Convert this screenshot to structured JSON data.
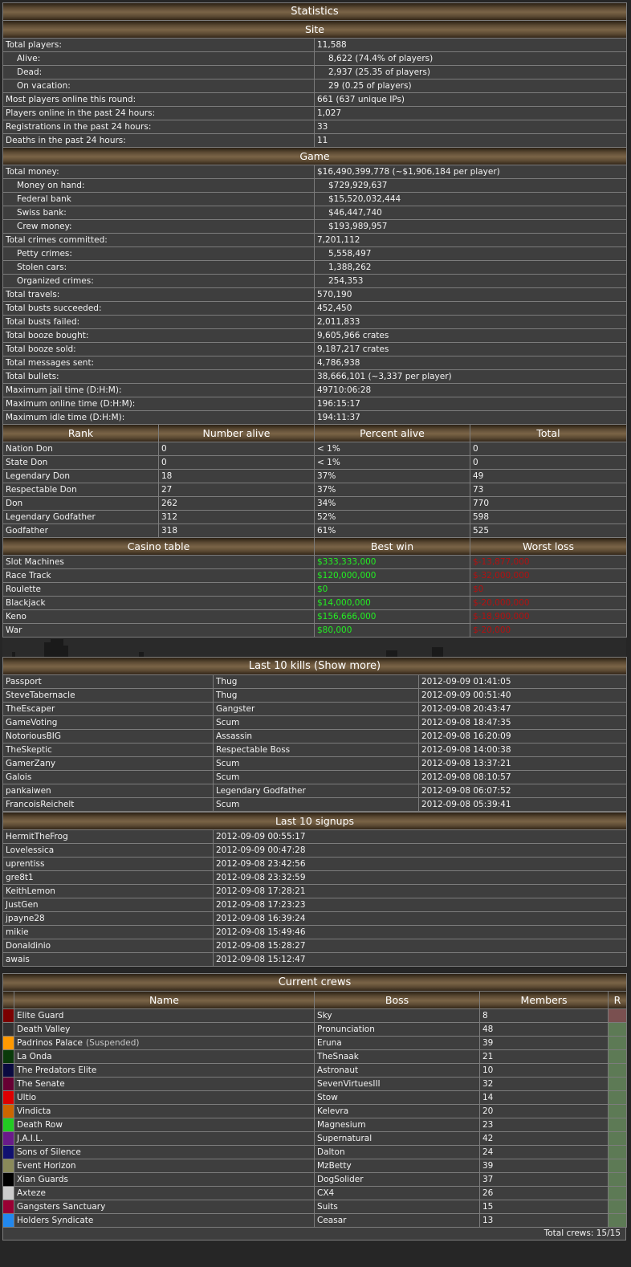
{
  "stats": {
    "title": "Statistics",
    "site": {
      "title": "Site",
      "rows": [
        {
          "label": "Total players:",
          "value": "11,588",
          "indent": false
        },
        {
          "label": "Alive:",
          "value": "8,622 (74.4% of players)",
          "indent": true
        },
        {
          "label": "Dead:",
          "value": "2,937 (25.35 of players)",
          "indent": true
        },
        {
          "label": "On vacation:",
          "value": "29 (0.25 of players)",
          "indent": true
        },
        {
          "label": "Most players online this round:",
          "value": "661 (637 unique IPs)",
          "indent": false
        },
        {
          "label": "Players online in the past 24 hours:",
          "value": "1,027",
          "indent": false
        },
        {
          "label": "Registrations in the past 24 hours:",
          "value": "33",
          "indent": false
        },
        {
          "label": "Deaths in the past 24 hours:",
          "value": "11",
          "indent": false
        }
      ]
    },
    "game": {
      "title": "Game",
      "rows": [
        {
          "label": "Total money:",
          "value": "$16,490,399,778 (~$1,906,184 per player)",
          "indent": false
        },
        {
          "label": "Money on hand:",
          "value": "$729,929,637",
          "indent": true
        },
        {
          "label": "Federal bank",
          "value": "$15,520,032,444",
          "indent": true
        },
        {
          "label": "Swiss bank:",
          "value": "$46,447,740",
          "indent": true
        },
        {
          "label": "Crew money:",
          "value": "$193,989,957",
          "indent": true
        },
        {
          "label": "Total crimes committed:",
          "value": "7,201,112",
          "indent": false
        },
        {
          "label": "Petty crimes:",
          "value": "5,558,497",
          "indent": true
        },
        {
          "label": "Stolen cars:",
          "value": "1,388,262",
          "indent": true
        },
        {
          "label": "Organized crimes:",
          "value": "254,353",
          "indent": true
        },
        {
          "label": "Total travels:",
          "value": "570,190",
          "indent": false
        },
        {
          "label": "Total busts succeeded:",
          "value": "452,450",
          "indent": false
        },
        {
          "label": "Total busts failed:",
          "value": "2,011,833",
          "indent": false
        },
        {
          "label": "Total booze bought:",
          "value": "9,605,966 crates",
          "indent": false
        },
        {
          "label": "Total booze sold:",
          "value": "9,187,217 crates",
          "indent": false
        },
        {
          "label": "Total messages sent:",
          "value": "4,786,938",
          "indent": false
        },
        {
          "label": "Total bullets:",
          "value": "38,666,101 (~3,337 per player)",
          "indent": false
        },
        {
          "label": "Maximum jail time (D:H:M):",
          "value": "49710:06:28",
          "indent": false
        },
        {
          "label": "Maximum online time (D:H:M):",
          "value": "196:15:17",
          "indent": false
        },
        {
          "label": "Maximum idle time (D:H:M):",
          "value": "194:11:37",
          "indent": false
        }
      ]
    },
    "ranks": {
      "headers": [
        "Rank",
        "Number alive",
        "Percent alive",
        "Total"
      ],
      "rows": [
        [
          "Nation Don",
          "0",
          "< 1%",
          "0"
        ],
        [
          "State Don",
          "0",
          "< 1%",
          "0"
        ],
        [
          "Legendary Don",
          "18",
          "37%",
          "49"
        ],
        [
          "Respectable Don",
          "27",
          "37%",
          "73"
        ],
        [
          "Don",
          "262",
          "34%",
          "770"
        ],
        [
          "Legendary Godfather",
          "312",
          "52%",
          "598"
        ],
        [
          "Godfather",
          "318",
          "61%",
          "525"
        ]
      ]
    },
    "casino": {
      "headers": [
        "Casino table",
        "Best win",
        "Worst loss"
      ],
      "rows": [
        [
          "Slot Machines",
          "$333,333,000",
          "$-13,877,000"
        ],
        [
          "Race Track",
          "$120,000,000",
          "$-32,000,000"
        ],
        [
          "Roulette",
          "$0",
          "$0"
        ],
        [
          "Blackjack",
          "$14,000,000",
          "$-20,000,000"
        ],
        [
          "Keno",
          "$156,666,000",
          "$-18,900,000"
        ],
        [
          "War",
          "$80,000",
          "$-20,000"
        ]
      ],
      "win_color": "#22ee22",
      "loss_color": "#b41010"
    }
  },
  "kills": {
    "title": "Last 10 kills (Show more)",
    "rows": [
      [
        "Passport",
        "Thug",
        "2012-09-09 01:41:05"
      ],
      [
        "SteveTabernacle",
        "Thug",
        "2012-09-09 00:51:40"
      ],
      [
        "TheEscaper",
        "Gangster",
        "2012-09-08 20:43:47"
      ],
      [
        "GameVoting",
        "Scum",
        "2012-09-08 18:47:35"
      ],
      [
        "NotoriousBIG",
        "Assassin",
        "2012-09-08 16:20:09"
      ],
      [
        "TheSkeptic",
        "Respectable Boss",
        "2012-09-08 14:00:38"
      ],
      [
        "GamerZany",
        "Scum",
        "2012-09-08 13:37:21"
      ],
      [
        "Galois",
        "Scum",
        "2012-09-08 08:10:57"
      ],
      [
        "pankaiwen",
        "Legendary Godfather",
        "2012-09-08 06:07:52"
      ],
      [
        "FrancoisReichelt",
        "Scum",
        "2012-09-08 05:39:41"
      ]
    ]
  },
  "signups": {
    "title": "Last 10 signups",
    "rows": [
      [
        "HermitTheFrog",
        "2012-09-09 00:55:17"
      ],
      [
        "Lovelessica",
        "2012-09-09 00:47:28"
      ],
      [
        "uprentiss",
        "2012-09-08 23:42:56"
      ],
      [
        "gre8t1",
        "2012-09-08 23:32:59"
      ],
      [
        "KeithLemon",
        "2012-09-08 17:28:21"
      ],
      [
        "JustGen",
        "2012-09-08 17:23:23"
      ],
      [
        "jpayne28",
        "2012-09-08 16:39:24"
      ],
      [
        "mikie",
        "2012-09-08 15:49:46"
      ],
      [
        "Donaldinio",
        "2012-09-08 15:28:27"
      ],
      [
        "awais",
        "2012-09-08 15:12:47"
      ]
    ]
  },
  "crews": {
    "title": "Current crews",
    "headers": [
      "Name",
      "Boss",
      "Members",
      "R"
    ],
    "rows": [
      {
        "color": "#7a0000",
        "name": "Elite Guard",
        "suspended": "",
        "boss": "Sky",
        "members": "8"
      },
      {
        "color": "#333333",
        "name": "Death Valley",
        "suspended": "",
        "boss": "Pronunciation",
        "members": "48"
      },
      {
        "color": "#ff9900",
        "name": "Padrinos Palace",
        "suspended": "(Suspended)",
        "boss": "Eruna",
        "members": "39"
      },
      {
        "color": "#0a3a0a",
        "name": "La Onda",
        "suspended": "",
        "boss": "TheSnaak",
        "members": "21"
      },
      {
        "color": "#0a0a40",
        "name": "The Predators Elite",
        "suspended": "",
        "boss": "Astronaut",
        "members": "10"
      },
      {
        "color": "#660033",
        "name": "The Senate",
        "suspended": "",
        "boss": "SevenVirtuesIII",
        "members": "32"
      },
      {
        "color": "#dd0000",
        "name": "Ultio",
        "suspended": "",
        "boss": "Stow",
        "members": "14"
      },
      {
        "color": "#cc6600",
        "name": "Vindicta",
        "suspended": "",
        "boss": "Kelevra",
        "members": "20"
      },
      {
        "color": "#22cc22",
        "name": "Death Row",
        "suspended": "",
        "boss": "Magnesium",
        "members": "23"
      },
      {
        "color": "#6a1a8a",
        "name": "J.A.I.L.",
        "suspended": "",
        "boss": "Supernatural",
        "members": "42"
      },
      {
        "color": "#101070",
        "name": "Sons of Silence",
        "suspended": "",
        "boss": "Dalton",
        "members": "24"
      },
      {
        "color": "#8a8a5a",
        "name": "Event Horizon",
        "suspended": "",
        "boss": "MzBetty",
        "members": "39"
      },
      {
        "color": "#000000",
        "name": "Xian Guards",
        "suspended": "",
        "boss": "DogSolider",
        "members": "37"
      },
      {
        "color": "#cccccc",
        "name": "Axteze",
        "suspended": "",
        "boss": "CX4",
        "members": "26"
      },
      {
        "color": "#990033",
        "name": "Gangsters Sanctuary",
        "suspended": "",
        "boss": "Suits",
        "members": "15"
      },
      {
        "color": "#2288ee",
        "name": "Holders Syndicate",
        "suspended": "",
        "boss": "Ceasar",
        "members": "13"
      }
    ],
    "total": "Total crews: 15/15"
  }
}
